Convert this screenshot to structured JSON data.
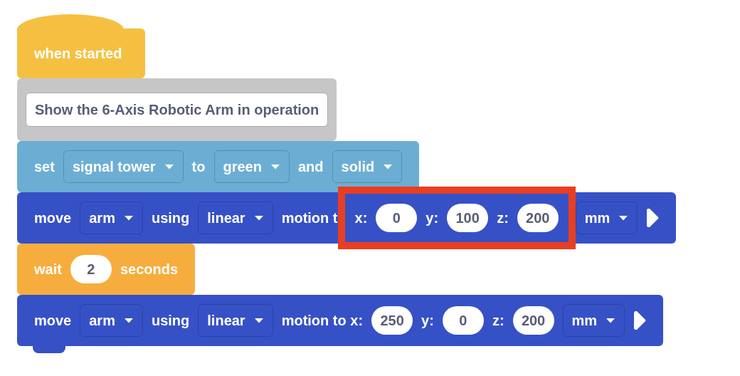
{
  "blocks": [
    {
      "kind": "hat",
      "color": "#f5c042",
      "parts": [
        {
          "kind": "label",
          "text": "when started"
        }
      ]
    },
    {
      "kind": "comment",
      "color": "#c6c6c6",
      "parts": [
        {
          "kind": "text_field",
          "text": "Show the 6-Axis Robotic Arm in operation"
        }
      ]
    },
    {
      "kind": "stack",
      "color": "#6caed3",
      "parts": [
        {
          "kind": "label",
          "text": "set"
        },
        {
          "kind": "dropdown",
          "text": "signal tower"
        },
        {
          "kind": "label",
          "text": "to"
        },
        {
          "kind": "dropdown",
          "text": "green"
        },
        {
          "kind": "label",
          "text": "and"
        },
        {
          "kind": "dropdown",
          "text": "solid"
        }
      ]
    },
    {
      "kind": "stack",
      "color": "#3651c6",
      "parts": [
        {
          "kind": "label",
          "text": "move"
        },
        {
          "kind": "dropdown",
          "text": "arm"
        },
        {
          "kind": "label",
          "text": "using"
        },
        {
          "kind": "dropdown",
          "text": "linear"
        },
        {
          "kind": "label",
          "text": "motion t"
        },
        {
          "kind": "highlight",
          "parts": [
            {
              "kind": "label",
              "text": "x:"
            },
            {
              "kind": "number",
              "text": "0"
            },
            {
              "kind": "label",
              "text": "y:"
            },
            {
              "kind": "number",
              "text": "100"
            },
            {
              "kind": "label",
              "text": "z:"
            },
            {
              "kind": "number",
              "text": "200"
            }
          ]
        },
        {
          "kind": "dropdown",
          "text": "mm"
        },
        {
          "kind": "run"
        }
      ]
    },
    {
      "kind": "stack",
      "color": "#f6ad3d",
      "parts": [
        {
          "kind": "label",
          "text": "wait"
        },
        {
          "kind": "number",
          "text": "2"
        },
        {
          "kind": "label",
          "text": "seconds"
        }
      ]
    },
    {
      "kind": "stack",
      "color": "#3651c6",
      "parts": [
        {
          "kind": "label",
          "text": "move"
        },
        {
          "kind": "dropdown",
          "text": "arm"
        },
        {
          "kind": "label",
          "text": "using"
        },
        {
          "kind": "dropdown",
          "text": "linear"
        },
        {
          "kind": "label",
          "text": "motion to x:"
        },
        {
          "kind": "number",
          "text": "250"
        },
        {
          "kind": "label",
          "text": "y:"
        },
        {
          "kind": "number",
          "text": "0"
        },
        {
          "kind": "label",
          "text": "z:"
        },
        {
          "kind": "number",
          "text": "200"
        },
        {
          "kind": "dropdown",
          "text": "mm"
        },
        {
          "kind": "run"
        }
      ]
    }
  ]
}
